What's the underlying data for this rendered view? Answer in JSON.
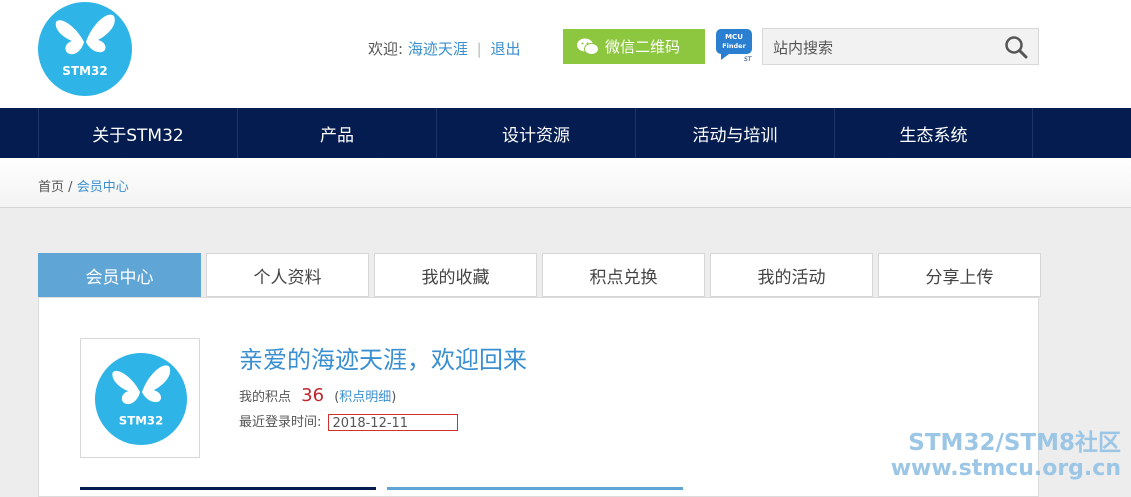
{
  "header": {
    "logo_text": "STM32",
    "welcome_prefix": "欢迎:",
    "username": "海迹天涯",
    "logout": "退出",
    "wechat_button": "微信二维码",
    "mcu_finder_text_1": "MCU",
    "mcu_finder_text_2": "Finder",
    "search_placeholder": "站内搜索"
  },
  "nav": {
    "items": [
      "关于STM32",
      "产品",
      "设计资源",
      "活动与培训",
      "生态系统"
    ]
  },
  "breadcrumb": {
    "home": "首页",
    "separator": "/",
    "current": "会员中心"
  },
  "tabs": [
    "会员中心",
    "个人资料",
    "我的收藏",
    "积点兑换",
    "我的活动",
    "分享上传"
  ],
  "profile": {
    "avatar_text": "STM32",
    "greeting": "亲爱的海迹天涯，欢迎回来",
    "points_label": "我的积点",
    "points_value": "36",
    "points_detail_open": "(",
    "points_detail_link": "积点明细",
    "points_detail_close": ")",
    "last_login_label": "最近登录时间:",
    "last_login_value": "2018-12-11"
  },
  "watermark": {
    "line1": "STM32/STM8社区",
    "line2": "www.stmcu.org.cn"
  },
  "colors": {
    "nav_bg": "#041c4f",
    "accent_blue": "#3a8fd0",
    "active_tab": "#5fa6d6",
    "wechat_green": "#8dc63f",
    "points_red": "#c0262d"
  }
}
